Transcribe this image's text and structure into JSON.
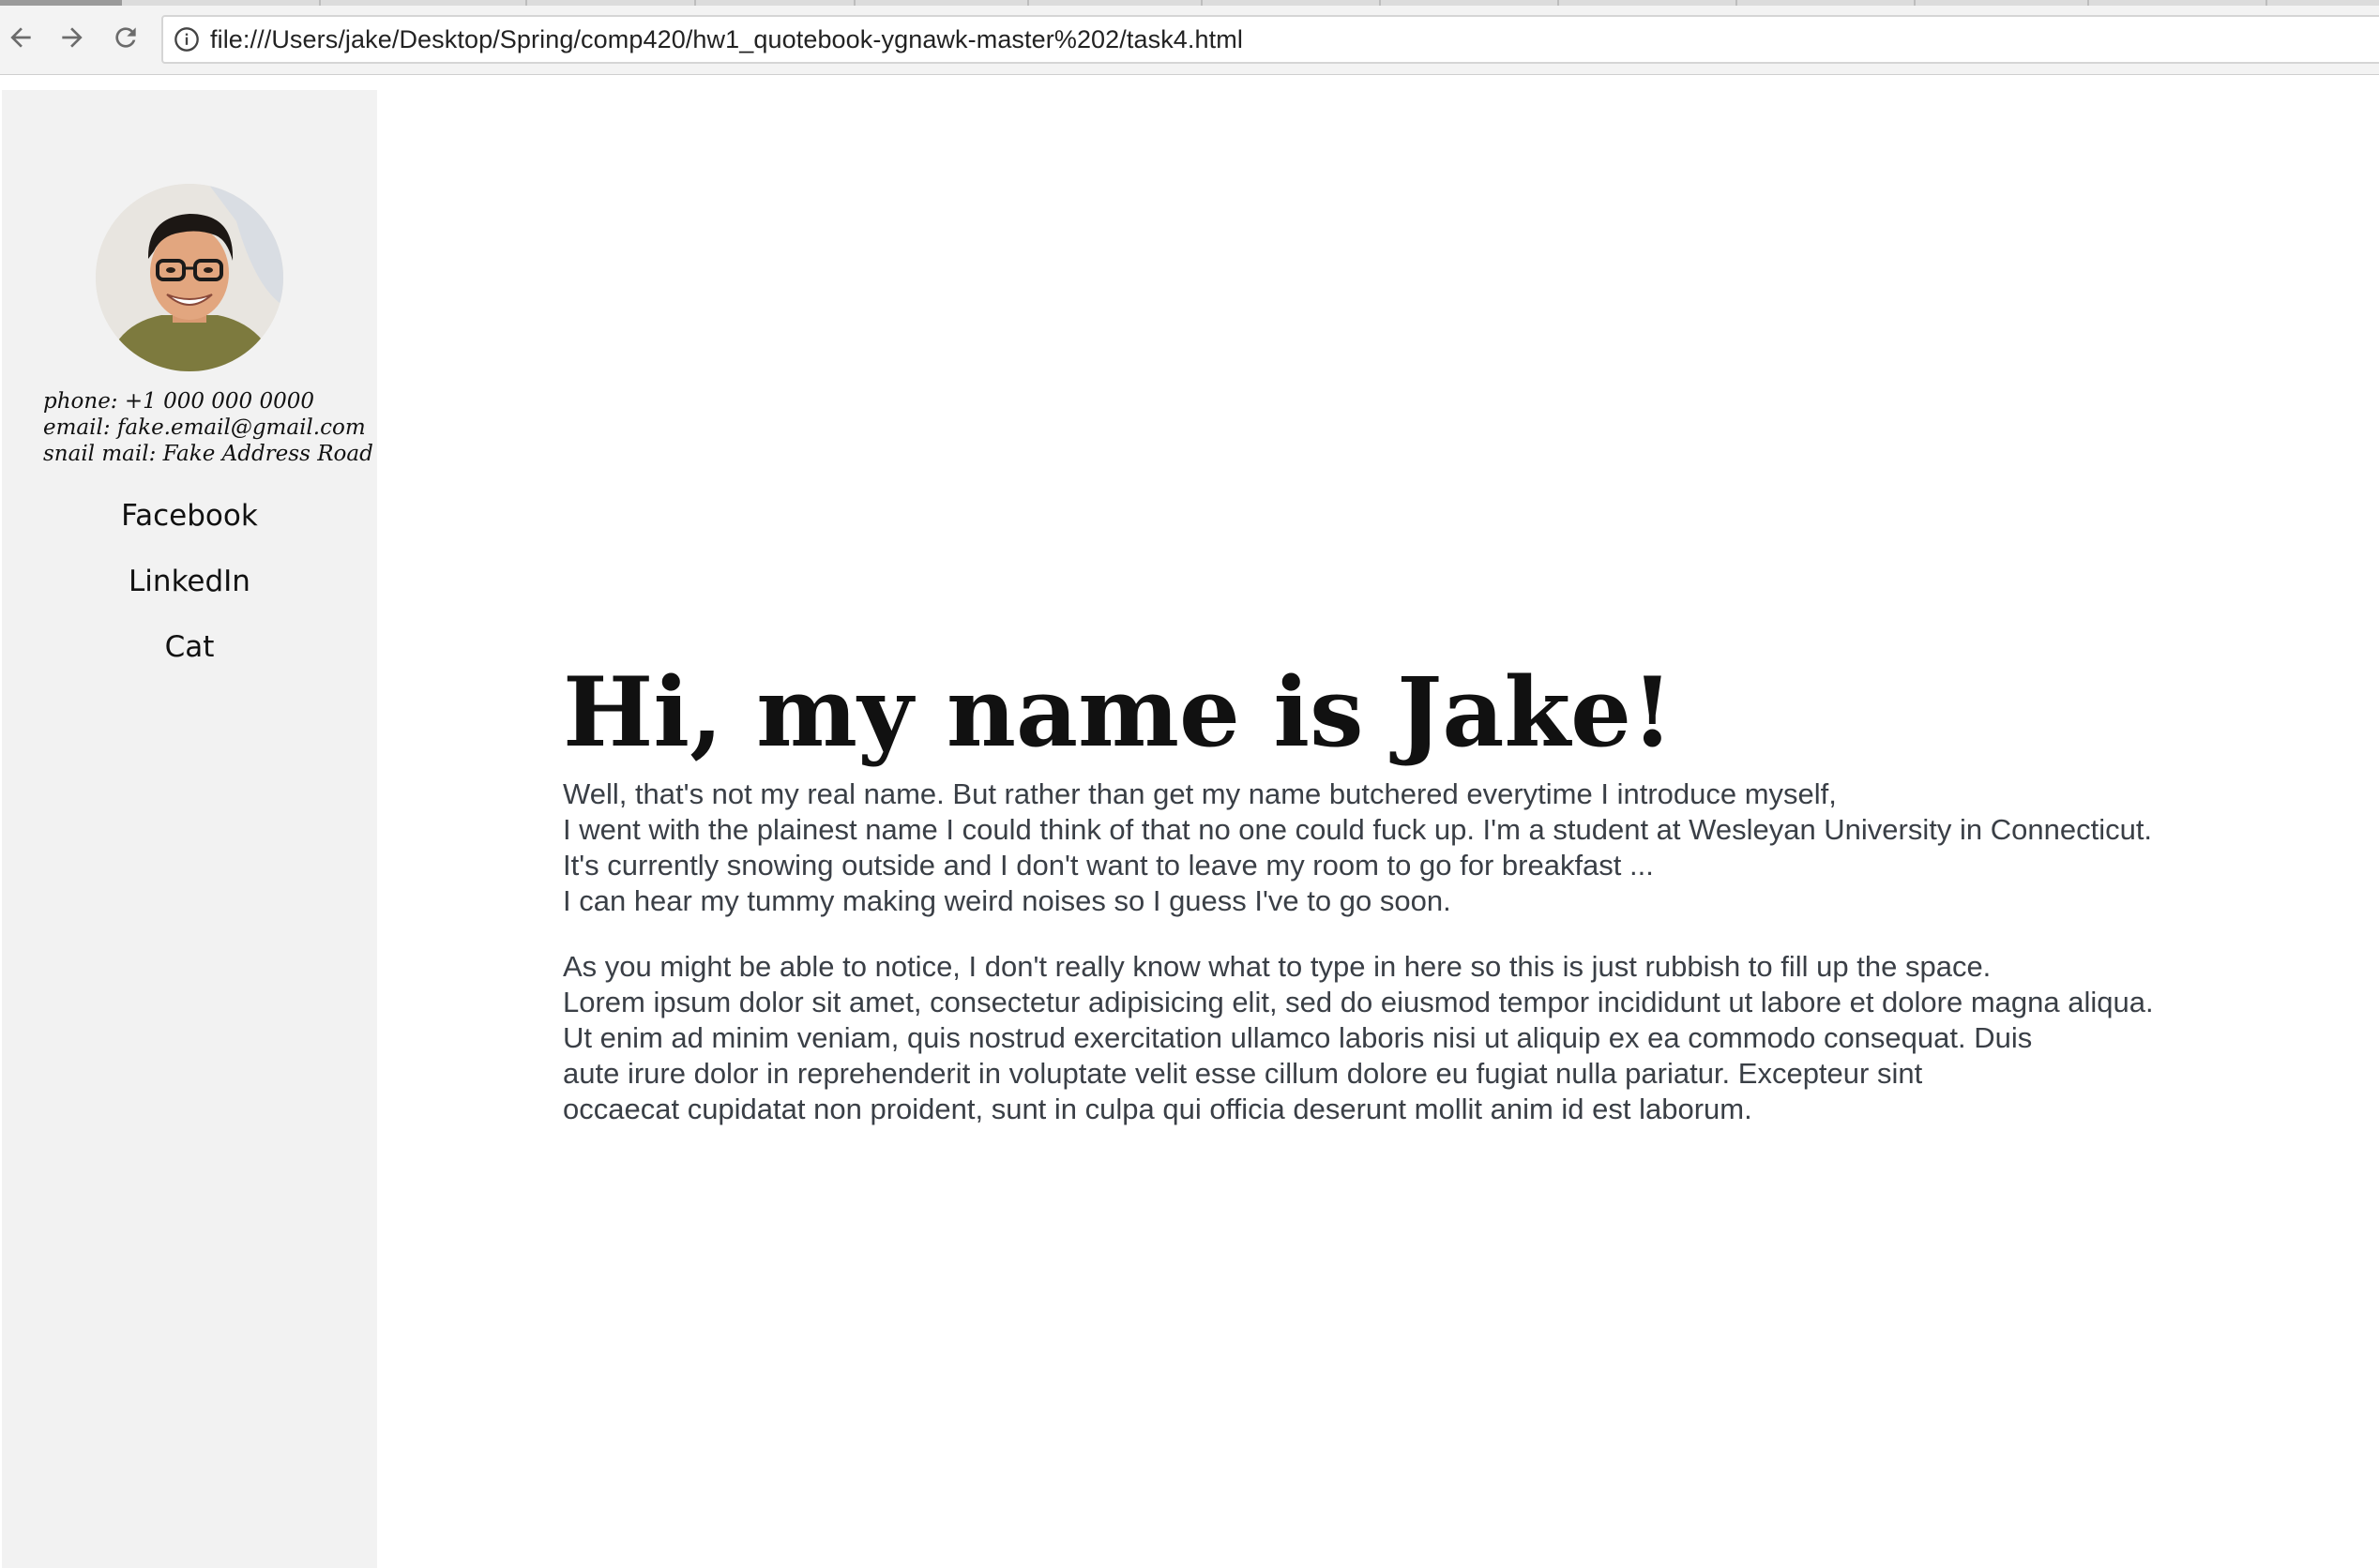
{
  "browser": {
    "url": "file:///Users/jake/Desktop/Spring/comp420/hw1_quotebook-ygnawk-master%202/task4.html",
    "back_icon": "back-arrow-icon",
    "forward_icon": "forward-arrow-icon",
    "reload_icon": "reload-icon",
    "info_icon": "info-icon"
  },
  "sidebar": {
    "contact": {
      "phone": "phone: +1 000 000 0000",
      "email": "email: fake.email@gmail.com",
      "mail": "snail mail: Fake Address Road"
    },
    "links": [
      {
        "label": "Facebook"
      },
      {
        "label": "LinkedIn"
      },
      {
        "label": "Cat"
      }
    ]
  },
  "main": {
    "title": "Hi, my name is Jake!",
    "paragraph1": [
      "Well, that's not my real name. But rather than get my name butchered everytime I introduce myself,",
      "I went with the plainest name I could think of that no one could fuck up. I'm a student at Wesleyan University in Connecticut.",
      "It's currently snowing outside and I don't want to leave my room to go for breakfast ...",
      "I can hear my tummy making weird noises so I guess I've to go soon."
    ],
    "paragraph2": [
      "As you might be able to notice, I don't really know what to type in here so this is just rubbish to fill up the space.",
      "Lorem ipsum dolor sit amet, consectetur adipisicing elit, sed do eiusmod tempor incididunt ut labore et dolore magna aliqua.",
      "Ut enim ad minim veniam, quis nostrud exercitation ullamco laboris nisi ut aliquip ex ea commodo consequat. Duis",
      "aute irure dolor in reprehenderit in voluptate velit esse cillum dolore eu fugiat nulla pariatur. Excepteur sint",
      "occaecat cupidatat non proident, sunt in culpa qui officia deserunt mollit anim id est laborum."
    ]
  }
}
